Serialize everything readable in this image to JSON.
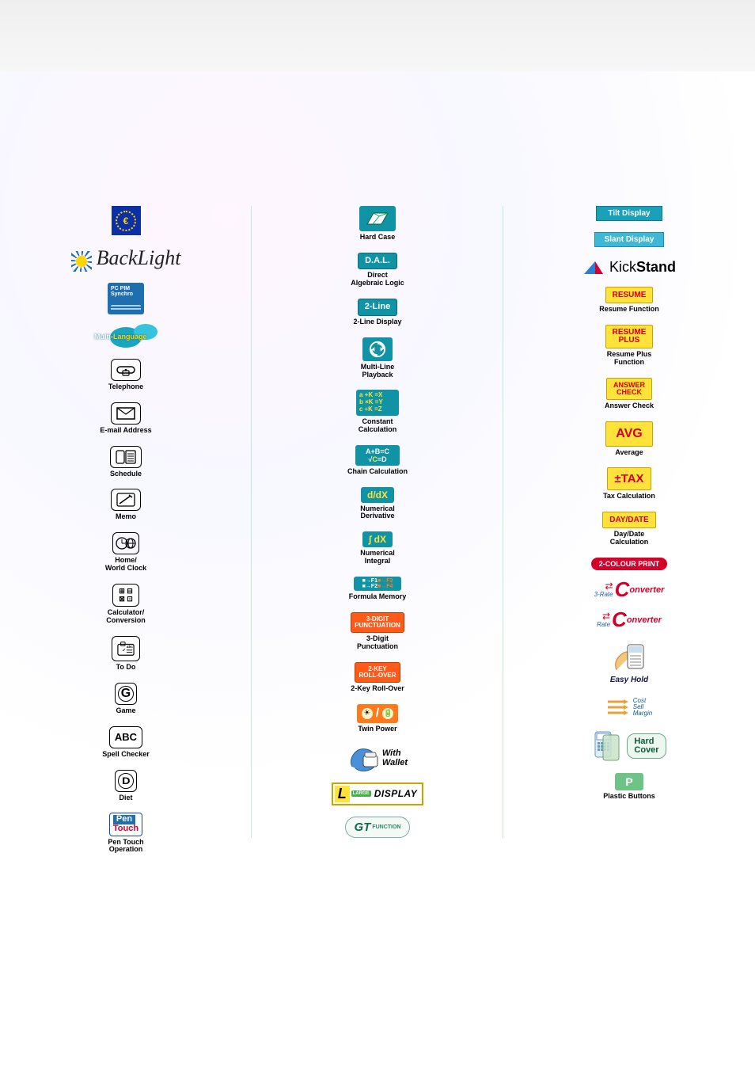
{
  "col1": {
    "euro": "€",
    "backlight": "BackLight",
    "pcpim_l1": "PC PIM",
    "pcpim_l2": "Synchro",
    "multilang_a": "Multi-",
    "multilang_b": "Language",
    "telephone": "Telephone",
    "email": "E-mail Address",
    "schedule": "Schedule",
    "memo": "Memo",
    "worldclock": "Home/\nWorld Clock",
    "calc": "Calculator/\nConversion",
    "todo": "To Do",
    "game": "Game",
    "game_g": "G",
    "abc": "ABC",
    "spell": "Spell Checker",
    "diet_d": "D",
    "diet": "Diet",
    "pentouch_pen": "Pen",
    "pentouch_touch": "Touch",
    "pentouch_label": "Pen Touch\nOperation"
  },
  "col2": {
    "hardcase": "Hard Case",
    "dal_badge": "D.A.L.",
    "dal_label": "Direct\nAlgebraic Logic",
    "twoline_badge": "2-Line",
    "twoline_label": "2-Line Display",
    "playback_label": "Multi-Line\nPlayback",
    "const_box": "a +K =X\nb ×K =Y\nc ÷K =Z",
    "const_label": "Constant\nCalculation",
    "chain_l1": "A+B=C",
    "chain_l2_a": "√",
    "chain_l2_b": "C",
    "chain_l2_c": "=D",
    "chain_label": "Chain Calculation",
    "ddx": "d/dX",
    "ddx_label": "Numerical\nDerivative",
    "idx": "∫ dX",
    "idx_label": "Numerical\nIntegral",
    "fmem_l1a": "■→F1",
    "fmem_l1b": "■→F3",
    "fmem_l2a": "■→F2",
    "fmem_l2b": "■→F4",
    "fmem_label": "Formula Memory",
    "punct_box": "3-DIGIT\nPUNCTUATION",
    "punct_label": "3-Digit\nPunctuation",
    "roll_box": "2-KEY\nROLL-OVER",
    "roll_label": "2-Key Roll-Over",
    "twin_label": "Twin Power",
    "wallet_a": "With",
    "wallet_b": "Wallet",
    "ldisplay_large": "LARGE",
    "ldisplay_L": "L",
    "ldisplay_rest": "DISPLAY",
    "gt_g": "GT",
    "gt_fn": "FUNCTION"
  },
  "col3": {
    "tilt": "Tilt Display",
    "slant": "Slant Display",
    "kick_a": "Kick",
    "kick_b": "Stand",
    "resume_badge": "RESUME",
    "resume_label": "Resume Function",
    "resumeplus_badge": "RESUME\nPLUS",
    "resumeplus_label": "Resume Plus\nFunction",
    "answer_badge": "ANSWER\nCHECK",
    "answer_label": "Answer Check",
    "avg_badge": "AVG",
    "avg_label": "Average",
    "tax_badge": "±TAX",
    "tax_label": "Tax Calculation",
    "daydate_badge": "DAY/DATE",
    "daydate_label": "Day/Date\nCalculation",
    "twocolour": "2-COLOUR PRINT",
    "conv_3rate": "3-Rate",
    "conv_rate": "Rate",
    "conv_rest": "onverter",
    "easyhold": "Easy Hold",
    "csm": "Cost\nSell\nMargin",
    "hardcover_a": "Hard",
    "hardcover_b": "Cover",
    "plastic": "Plastic Buttons",
    "plastic_p": "P"
  }
}
